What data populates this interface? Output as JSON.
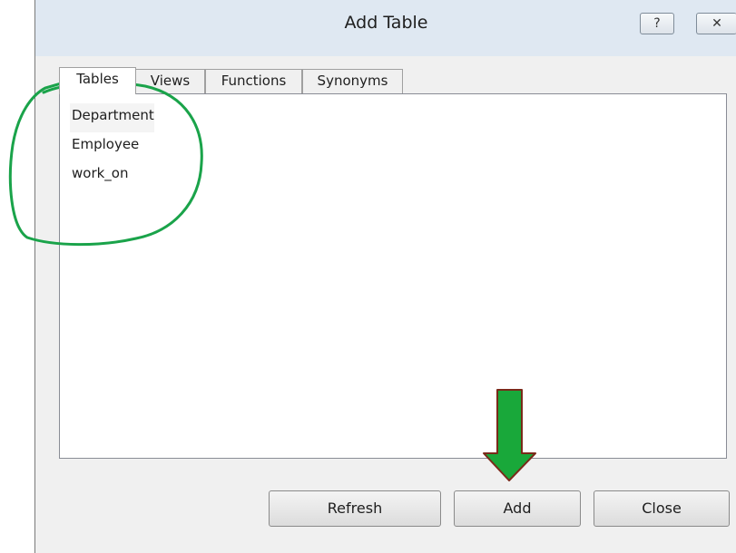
{
  "window": {
    "title": "Add Table",
    "help_glyph": "?",
    "close_glyph": "✕"
  },
  "tabs": [
    {
      "label": "Tables",
      "active": true
    },
    {
      "label": "Views",
      "active": false
    },
    {
      "label": "Functions",
      "active": false
    },
    {
      "label": "Synonyms",
      "active": false
    }
  ],
  "tables_list": [
    "Department",
    "Employee",
    "work_on"
  ],
  "selected_item": "Department",
  "buttons": {
    "refresh": "Refresh",
    "add": "Add",
    "close": "Close"
  },
  "annotations": {
    "circle_color": "#1aa34a",
    "arrow_fill": "#19a83a",
    "arrow_outline": "#7a2a1a",
    "arrow_direction": "down"
  }
}
